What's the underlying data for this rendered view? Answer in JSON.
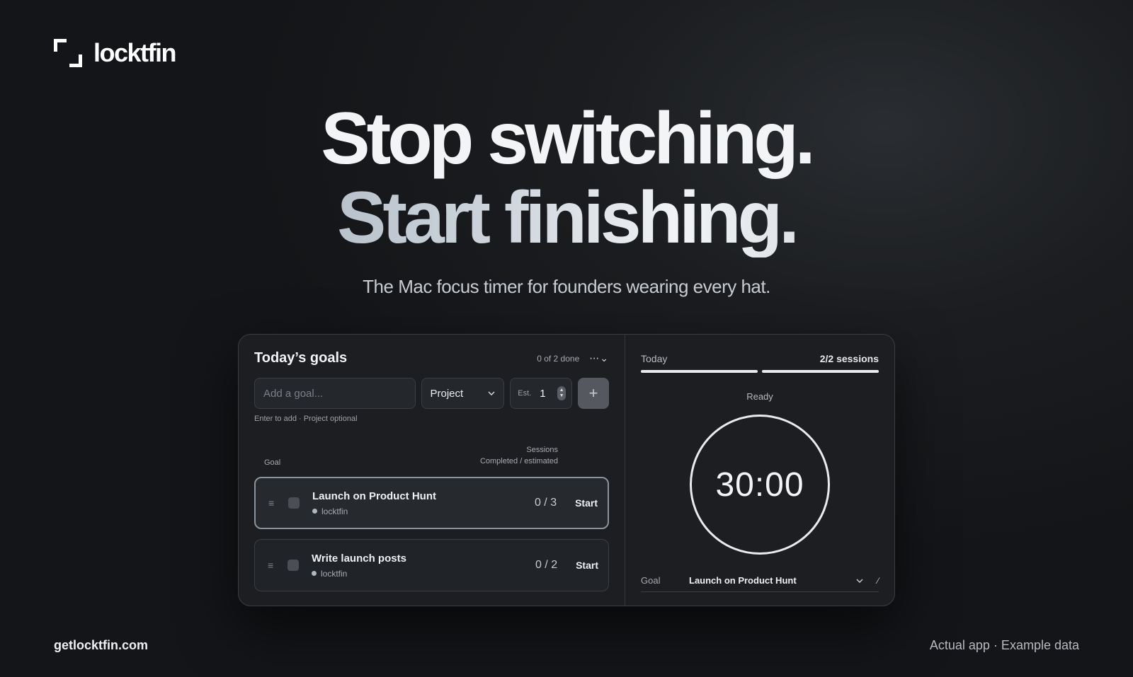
{
  "brand": {
    "name": "locktfin",
    "logo_icon": "bracket-corners-icon"
  },
  "hero": {
    "line1": "Stop switching.",
    "line2": "Start finishing.",
    "subtitle": "The Mac focus timer for founders wearing every hat."
  },
  "app": {
    "goals_panel": {
      "title": "Today’s goals",
      "done_text": "0 of 2 done",
      "menu_label": "⋯⌄",
      "input_placeholder": "Add a goal...",
      "project_select": "Project",
      "est_label": "Est.",
      "est_value": "1",
      "add_icon": "plus-icon",
      "hint": "Enter to add · Project optional",
      "col_goal": "Goal",
      "col_sessions": "Sessions",
      "col_sessions_sub": "Completed / estimated",
      "goals": [
        {
          "title": "Launch on Product Hunt",
          "project": "locktfin",
          "count": "0 / 3",
          "action": "Start",
          "active": true
        },
        {
          "title": "Write launch posts",
          "project": "locktfin",
          "count": "0 / 2",
          "action": "Start",
          "active": false
        }
      ]
    },
    "timer_panel": {
      "today_label": "Today",
      "sessions": "2/2 sessions",
      "progress_done": 2,
      "progress_total": 2,
      "status": "Ready",
      "time": "30:00",
      "goal_label": "Goal",
      "goal_value": "Launch on Product Hunt"
    }
  },
  "footer": {
    "url": "getlocktfin.com",
    "note": "Actual app · Example data"
  },
  "colors": {
    "background": "#1b1d20",
    "panel": "#1c1e21",
    "accent": "#e9ebed"
  }
}
